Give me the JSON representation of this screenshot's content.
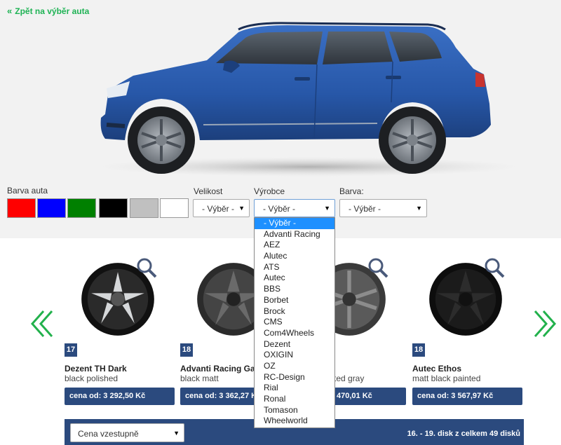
{
  "header": {
    "back_label": "Zpět na výběr auta"
  },
  "car": {
    "body_color": "#2757a8"
  },
  "color_picker": {
    "label": "Barva auta",
    "swatches": [
      "#ff0000",
      "#0000ff",
      "#008000",
      "#000000",
      "#c0c0c0",
      "#ffffff"
    ]
  },
  "filters": {
    "size": {
      "label": "Velikost",
      "value": "- Výběr -"
    },
    "maker": {
      "label": "Výrobce",
      "value": "- Výběr -"
    },
    "color": {
      "label": "Barva:",
      "value": "- Výběr -"
    }
  },
  "maker_options": [
    "- Výběr -",
    "Advanti Racing",
    "AEZ",
    "Alutec",
    "ATS",
    "Autec",
    "BBS",
    "Borbet",
    "Brock",
    "CMS",
    "Com4Wheels",
    "Dezent",
    "OXIGIN",
    "OZ",
    "RC-Design",
    "Rial",
    "Ronal",
    "Tomason",
    "Wheelworld"
  ],
  "wheels": [
    {
      "size": "17",
      "name": "Dezent TH Dark",
      "finish": "black polished",
      "price": "cena od: 3 292,50 Kč",
      "style": "polished"
    },
    {
      "size": "18",
      "name": "Advanti Racing Garro 1",
      "finish": "black matt",
      "price": "cena od: 3 362,27 Kč",
      "style": "matt"
    },
    {
      "size": "",
      "name": "",
      "finish": "ted gray",
      "price": "470,01 Kč",
      "style": "gray"
    },
    {
      "size": "18",
      "name": "Autec Ethos",
      "finish": "matt black painted",
      "price": "cena od: 3 567,97 Kč",
      "style": "black"
    }
  ],
  "sorting": {
    "value": "Cena vzestupně"
  },
  "pagination": {
    "text": "16. - 19. disk z celkem 49 disků"
  },
  "colors": {
    "accent": "#1fb355",
    "navy": "#2b4a7e",
    "highlight": "#1e90ff"
  }
}
